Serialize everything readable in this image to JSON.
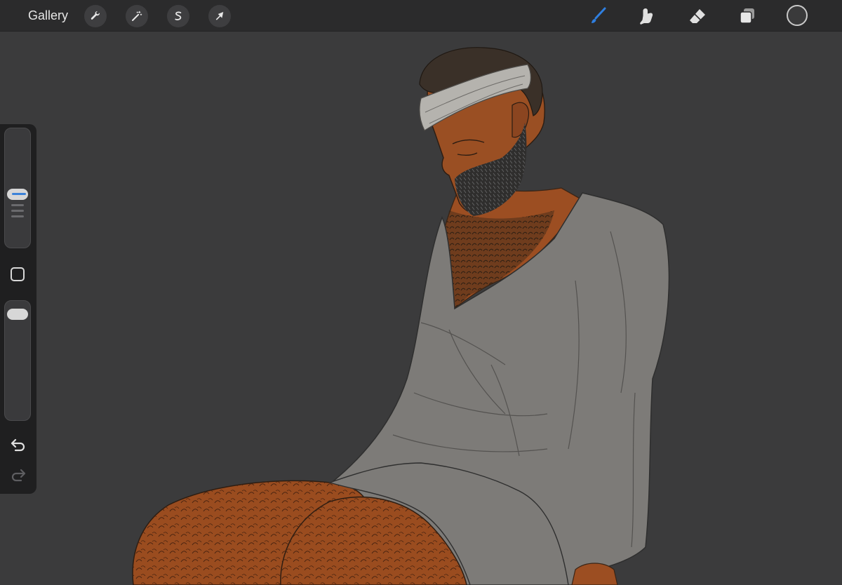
{
  "toolbar": {
    "gallery_label": "Gallery",
    "left_tools": [
      {
        "name": "actions",
        "icon": "wrench-icon"
      },
      {
        "name": "adjustments",
        "icon": "magic-wand-icon"
      },
      {
        "name": "selection",
        "icon": "selection-s-icon"
      },
      {
        "name": "transform",
        "icon": "arrow-cursor-icon"
      }
    ],
    "right_tools": [
      {
        "name": "brush",
        "icon": "brush-icon",
        "active": true
      },
      {
        "name": "smudge",
        "icon": "smudge-finger-icon"
      },
      {
        "name": "eraser",
        "icon": "eraser-icon"
      },
      {
        "name": "layers",
        "icon": "layers-icon"
      }
    ],
    "current_color": "#3a3a3b",
    "active_color": "#2f7fe0"
  },
  "sidebar": {
    "brush_size_level": 0.45,
    "opacity_level": 0.05,
    "modify_icon": "square-icon",
    "undo_icon": "undo-arrow-icon",
    "redo_icon": "redo-arrow-icon"
  },
  "canvas": {
    "background": "#3b3b3c",
    "artwork": "illustration-of-seated-man-with-bandaged-head"
  }
}
